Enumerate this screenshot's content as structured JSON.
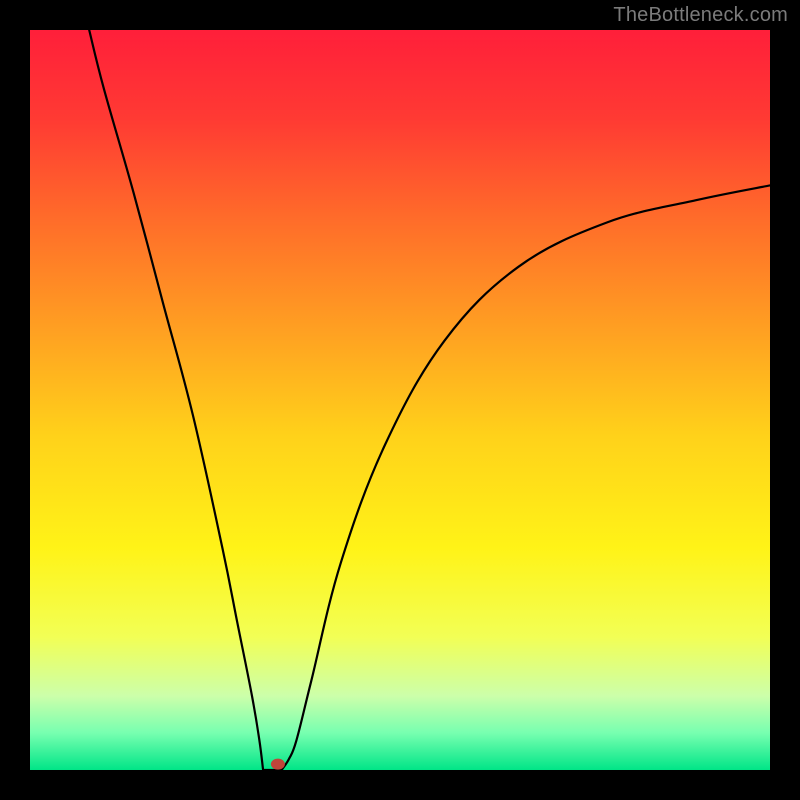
{
  "watermark": "TheBottleneck.com",
  "chart_data": {
    "type": "line",
    "title": "",
    "xlabel": "",
    "ylabel": "",
    "xlim": [
      0,
      100
    ],
    "ylim": [
      0,
      100
    ],
    "grid": false,
    "legend": false,
    "background_gradient_stops": [
      {
        "offset": 0.0,
        "color": "#ff1f3a"
      },
      {
        "offset": 0.12,
        "color": "#ff3a33"
      },
      {
        "offset": 0.25,
        "color": "#ff6a2a"
      },
      {
        "offset": 0.4,
        "color": "#ff9e22"
      },
      {
        "offset": 0.55,
        "color": "#ffd21a"
      },
      {
        "offset": 0.7,
        "color": "#fff317"
      },
      {
        "offset": 0.82,
        "color": "#f2ff55"
      },
      {
        "offset": 0.9,
        "color": "#ccffaa"
      },
      {
        "offset": 0.95,
        "color": "#77ffb0"
      },
      {
        "offset": 1.0,
        "color": "#00e587"
      }
    ],
    "series": [
      {
        "name": "bottleneck-curve",
        "type": "line",
        "color": "#000000",
        "x": [
          8,
          10,
          14,
          18,
          22,
          26,
          28,
          30,
          31,
          32,
          33,
          34,
          35,
          36,
          38,
          42,
          48,
          56,
          66,
          78,
          90,
          100
        ],
        "values": [
          100,
          92,
          78,
          63,
          48,
          30,
          20,
          10,
          4,
          1,
          0,
          0,
          1.5,
          4,
          12,
          28,
          44,
          58,
          68,
          74,
          77,
          79
        ]
      }
    ],
    "markers": [
      {
        "name": "target-point",
        "x": 33.5,
        "y": 0.8,
        "color": "#c0453a",
        "r": 1.2
      }
    ],
    "flat_segment": {
      "x_from": 31.5,
      "x_to": 34.0,
      "y": 0
    }
  }
}
